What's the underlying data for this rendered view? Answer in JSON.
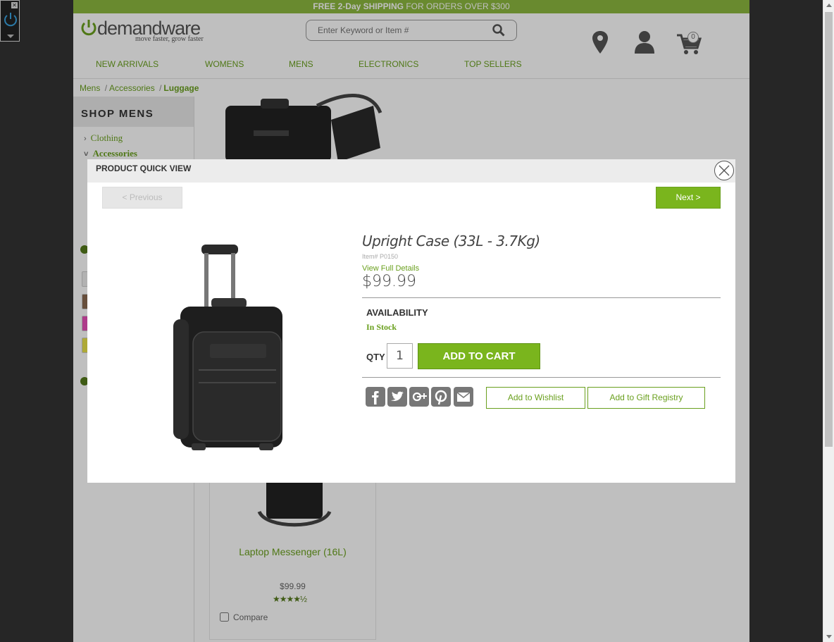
{
  "promo": {
    "bold": "FREE 2-Day SHIPPING",
    "rest": " FOR ORDERS OVER $300"
  },
  "logo": {
    "name": "demandware",
    "tagline": "move faster, grow faster"
  },
  "search": {
    "placeholder": "Enter Keyword or Item #"
  },
  "cart": {
    "count": "0"
  },
  "nav": [
    "NEW ARRIVALS",
    "WOMENS",
    "MENS",
    "ELECTRONICS",
    "TOP SELLERS"
  ],
  "breadcrumb": {
    "items": [
      "Mens",
      "Accessories"
    ],
    "current": "Luggage",
    "separator": "/"
  },
  "sidebar": {
    "title": "SHOP MENS",
    "items": [
      "Clothing",
      "Accessories"
    ]
  },
  "background_tile": {
    "name": "Laptop Messenger (16L)",
    "price": "$99.99",
    "rating": 4.5,
    "compare_label": "Compare"
  },
  "modal": {
    "title": "PRODUCT QUICK VIEW",
    "prev_label": "< Previous",
    "next_label": "Next >",
    "product_name": "Upright Case (33L - 3.7Kg)",
    "item_no": "Item# P0150",
    "full_details": "View Full Details",
    "price": "$99.99",
    "availability_label": "AVAILABILITY",
    "availability_value": "In Stock",
    "qty_label": "QTY",
    "qty_value": "1",
    "add_to_cart": "ADD TO CART",
    "wishlist": "Add to Wishlist",
    "gift_registry": "Add to Gift Registry",
    "share_icons": [
      "facebook-icon",
      "twitter-icon",
      "google-plus-icon",
      "pinterest-icon",
      "email-icon"
    ]
  },
  "colors": {
    "accent": "#7ab51d",
    "link": "#6aa01e",
    "promo_bg": "#8cb83f"
  }
}
